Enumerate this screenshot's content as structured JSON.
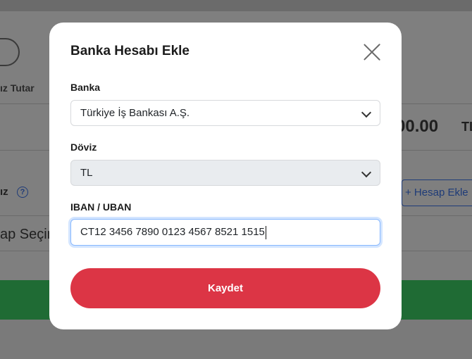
{
  "background": {
    "amount": "00.00",
    "currency": "TL",
    "tutar_label": "ız Tutar",
    "section_label": "ız",
    "help_icon": "question-circle-icon",
    "add_account_label": "+ Hesap Ekle",
    "select_placeholder": "ap Seçin"
  },
  "modal": {
    "title": "Banka Hesabı Ekle",
    "close_icon": "close-icon",
    "bank_label": "Banka",
    "bank_value": "Türkiye İş Bankası A.Ş.",
    "currency_label": "Döviz",
    "currency_value": "TL",
    "iban_label": "IBAN / UBAN",
    "iban_value": "CT12 3456 7890 0123 4567 8521 1515",
    "save_label": "Kaydet"
  },
  "colors": {
    "save_button": "#dc3545",
    "overlay": "#7f7f7f",
    "focus_border": "#86b7fe"
  }
}
